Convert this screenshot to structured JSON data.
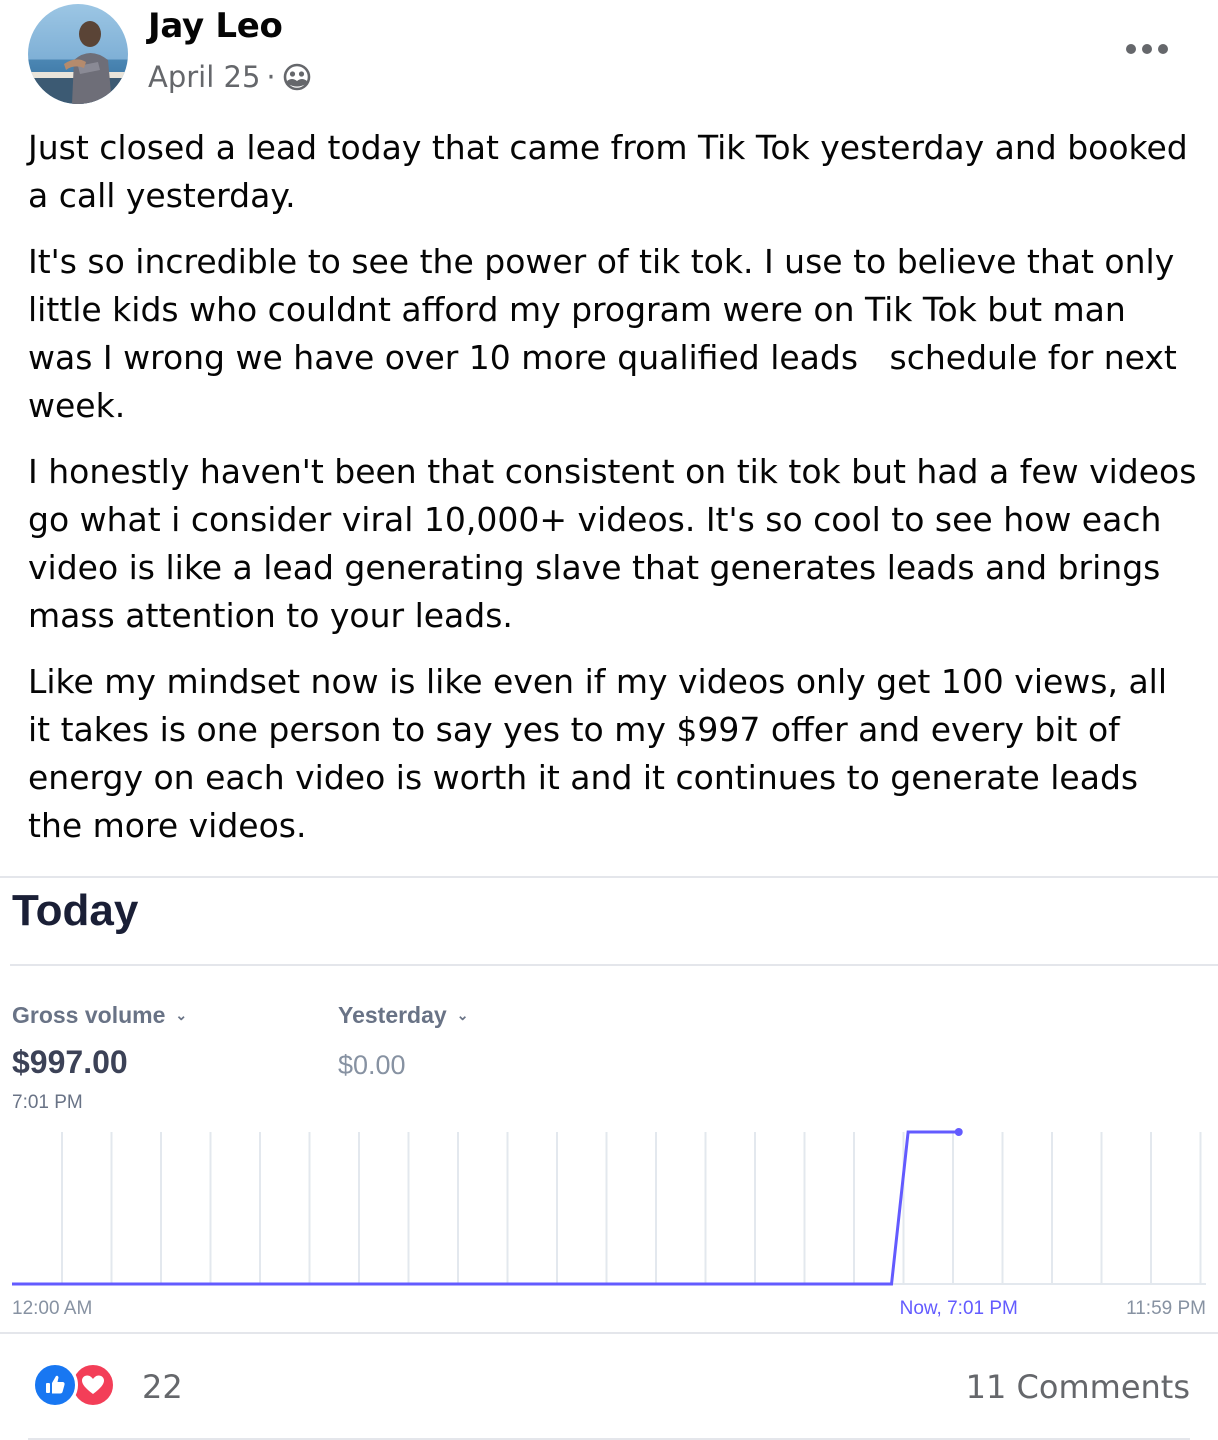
{
  "post": {
    "author": "Jay Leo",
    "date": "April 25",
    "separator": "·",
    "privacy_icon": "friends-icon",
    "more_icon": "more-options-icon",
    "paragraphs": [
      "Just closed a lead today that came from Tik Tok yesterday and booked a call yesterday.",
      "It's so incredible to see the power of tik tok. I use to believe that only little kids who couldnt afford my program were on Tik Tok but man was I wrong we have over 10 more qualified leads   schedule for next week.",
      "I honestly haven't been that consistent on tik tok but had a few videos go what i consider viral 10,000+ videos. It's so cool to see how each video is like a lead generating slave that generates leads and brings mass attention to your leads.",
      "Like my mindset now is like even if my videos only get 100 views, all it takes is one person to say yes to my $997 offer and every bit of energy on each video is worth it and it continues to generate leads the more videos."
    ]
  },
  "card": {
    "title": "Today",
    "metric_label": "Gross volume",
    "metric_value": "$997.00",
    "metric_time": "7:01 PM",
    "compare_label": "Yesterday",
    "compare_value": "$0.00",
    "accent_color": "#635bff"
  },
  "chart_data": {
    "type": "line",
    "series": [
      {
        "name": "",
        "x": [
          "12:00 AM",
          "5:40 PM",
          "6:00 PM",
          "7:01 PM"
        ],
        "values": [
          0,
          0,
          997,
          997
        ]
      }
    ],
    "x_tick_labels": [
      "12:00 AM",
      "Now, 7:01 PM",
      "11:59 PM"
    ],
    "ylim": [
      0,
      997
    ],
    "grid": "vertical"
  },
  "footer": {
    "reaction_count": "22",
    "comments": "11 Comments"
  }
}
